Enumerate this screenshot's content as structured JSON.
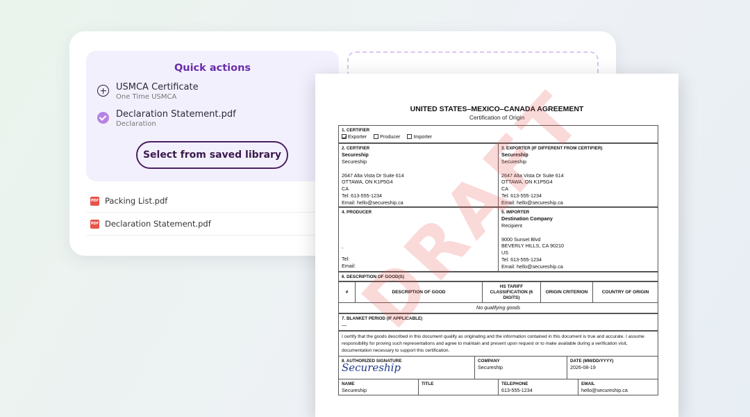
{
  "quick_actions": {
    "title": "Quick actions",
    "items": [
      {
        "icon": "plus-circle-icon",
        "label": "USMCA Certificate",
        "sub": "One Time USMCA"
      },
      {
        "icon": "check-circle-icon",
        "label": "Declaration Statement.pdf",
        "sub": "Declaration"
      }
    ],
    "button_label": "Select from saved library"
  },
  "files": [
    {
      "icon": "pdf-icon",
      "name": "Packing List.pdf"
    },
    {
      "icon": "pdf-icon",
      "name": "Declaration Statement.pdf"
    }
  ],
  "document": {
    "title": "UNITED STATES–MEXICO–CANADA AGREEMENT",
    "subtitle": "Certification of Origin",
    "watermark": "DRAFT",
    "section1": {
      "label": "1. CERTIFIER",
      "options": [
        "Exporter",
        "Producer",
        "Importer"
      ],
      "checked": "Exporter"
    },
    "section2": {
      "label": "2. CERTIFIER",
      "name": "Secureship",
      "company": "Secureship",
      "address1": "2647 Alta Vista Dr Suite 614",
      "address2": "OTTAWA, ON K1P5G4",
      "country": "CA",
      "tel": "Tel: 613-555-1234",
      "email": "Email: hello@secureship.ca"
    },
    "section3": {
      "label": "3. EXPORTER (IF DIFFERENT FROM CERTIFIER)",
      "name": "Secureship",
      "company": "Secureship",
      "address1": "2647 Alta Vista Dr Suite 614",
      "address2": "OTTAWA, ON K1P5G4",
      "country": "CA",
      "tel": "Tel: 613-555-1234",
      "email": "Email: hello@secureship.ca"
    },
    "section4": {
      "label": "4. PRODUCER",
      "dot": ",",
      "tel": "Tel:",
      "email": "Email:"
    },
    "section5": {
      "label": "5. IMPORTER",
      "name": "Destination Company",
      "company": "Recipient",
      "address1": "9000 Sunset Blvd",
      "address2": "BEVERLY HILLS, CA 90210",
      "country": "US",
      "tel": "Tel: 613-555-1234",
      "email": "Email: hello@secureship.ca"
    },
    "section6": {
      "label": "6. DESCRIPTION OF GOOD(S)",
      "headers": [
        "#",
        "DESCRIPTION OF GOOD",
        "HS TARIFF CLASSIFICATION (6 DIGITS)",
        "ORIGIN CRITERION",
        "COUNTRY OF ORIGIN"
      ],
      "empty": "No qualifying goods"
    },
    "section7": {
      "label": "7. BLANKET PERIOD (IF APPLICABLE)",
      "value": "—"
    },
    "certify_text": "I certify that the goods described in this document qualify as originating and the information contained in this document is true and accurate. I assume responsibility for proving such representations and agree to maintain and present upon request or to make available during a verification visit, documentation necessary to support this certification.",
    "section8": {
      "label": "8. AUTHORIZED SIGNATURE",
      "signature": "Secureship",
      "company_label": "COMPANY",
      "company": "Secureship",
      "date_label": "DATE (MM/DD/YYYY)",
      "date": "2026-08-19",
      "name_label": "NAME",
      "name": "Secureship",
      "title_label": "TITLE",
      "title": "",
      "phone_label": "TELEPHONE",
      "phone": "613-555-1234",
      "email_label": "EMAIL",
      "email": "hello@secureship.ca"
    }
  }
}
